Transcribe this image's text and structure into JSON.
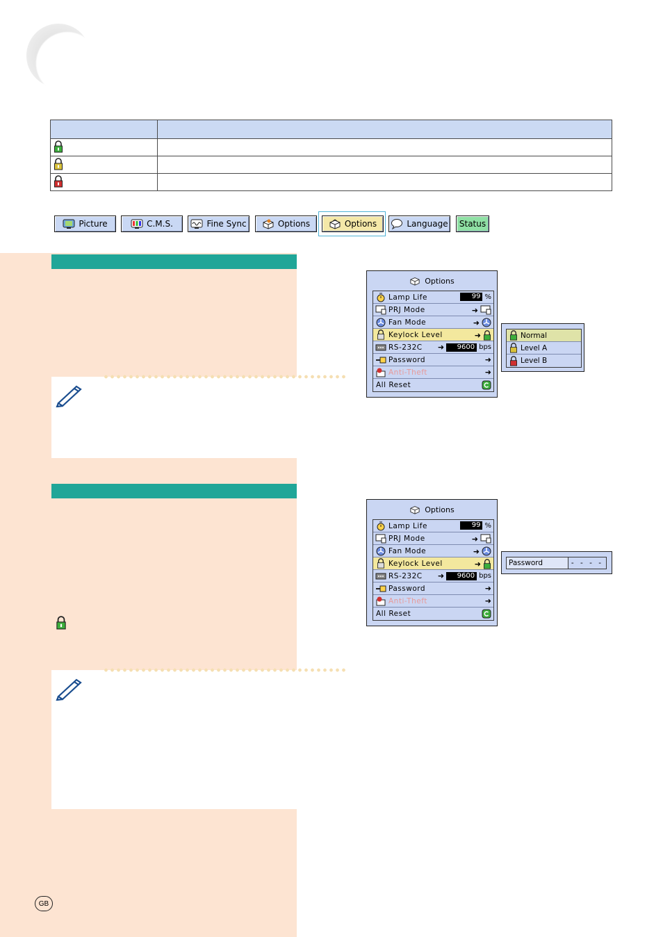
{
  "lock_table": {
    "rows": [
      {
        "icon": "lock-normal-icon",
        "color": "#3cae3c"
      },
      {
        "icon": "lock-level-a-icon",
        "color": "#d9c23a"
      },
      {
        "icon": "lock-level-b-icon",
        "color": "#d03030"
      }
    ]
  },
  "tabs": [
    {
      "label": "Picture",
      "icon": "picture-icon"
    },
    {
      "label": "C.M.S.",
      "icon": "cms-icon"
    },
    {
      "label": "Fine Sync",
      "icon": "fine-sync-icon"
    },
    {
      "label": "Options",
      "icon": "options-1-icon"
    },
    {
      "label": "Options",
      "icon": "options-2-icon",
      "active": true
    },
    {
      "label": "Language",
      "icon": "language-icon"
    },
    {
      "label": "Status"
    }
  ],
  "osd": {
    "title": "Options",
    "rows": {
      "lamp_life": {
        "label": "Lamp Life",
        "value": "99",
        "unit": "%"
      },
      "prj_mode": {
        "label": "PRJ Mode"
      },
      "fan_mode": {
        "label": "Fan Mode"
      },
      "keylock": {
        "label": "Keylock Level"
      },
      "rs232c": {
        "label": "RS-232C",
        "value": "9600",
        "unit": "bps"
      },
      "password": {
        "label": "Password"
      },
      "anti_theft": {
        "label": "Anti-Theft"
      },
      "all_reset": {
        "label": "All Reset"
      }
    }
  },
  "keylock_submenu": {
    "items": [
      {
        "label": "Normal",
        "selected": true
      },
      {
        "label": "Level A"
      },
      {
        "label": "Level B"
      }
    ]
  },
  "password_popup": {
    "label": "Password",
    "value": "- - - -"
  },
  "page_badge": "GB",
  "colors": {
    "section_bar": "#20a698",
    "side_panel": "#fde4d2",
    "table_header": "#cbdaf3",
    "osd_bg": "#cad6f3",
    "osd_selected": "#f3e89e"
  }
}
